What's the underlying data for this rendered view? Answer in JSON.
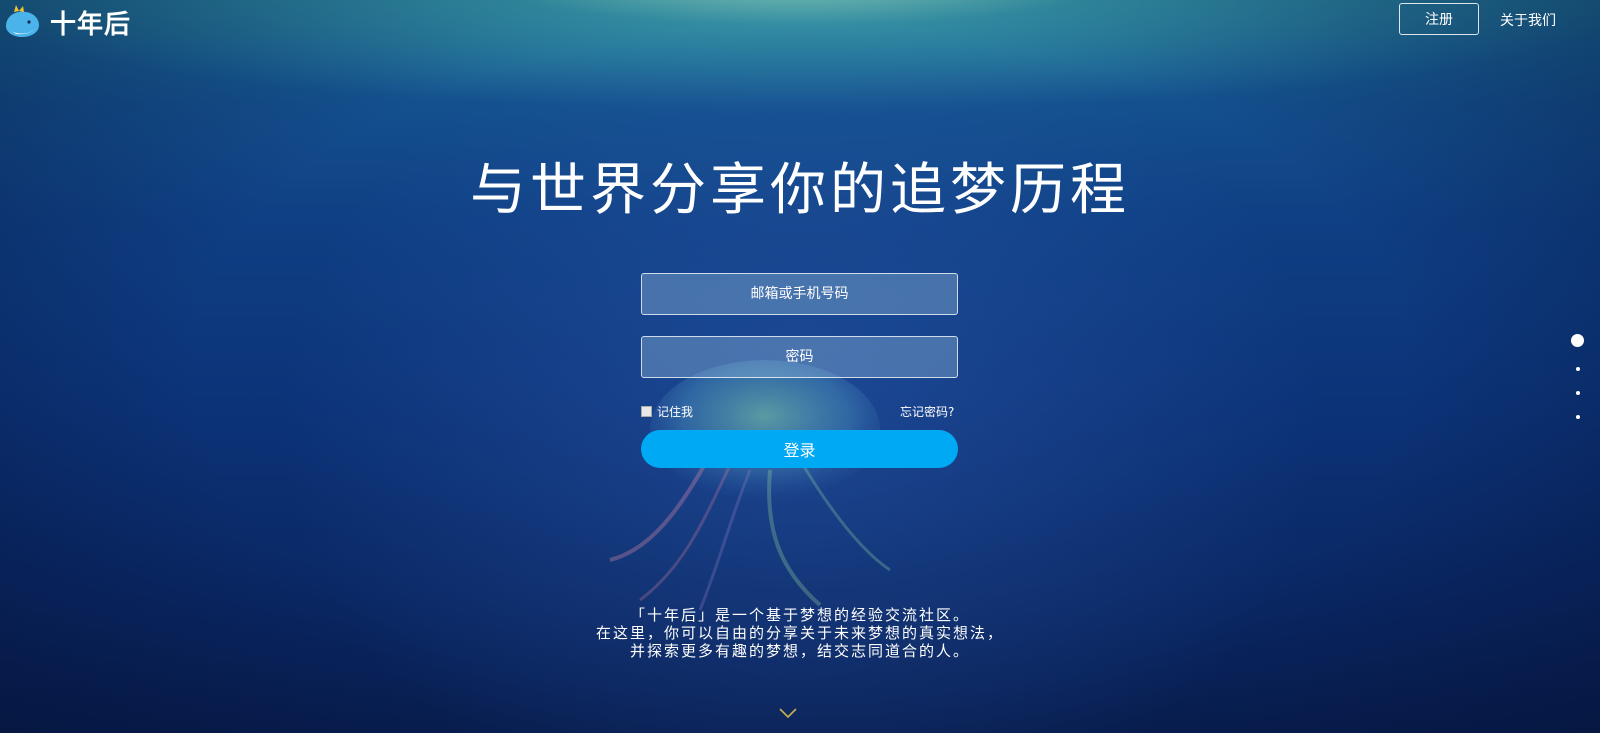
{
  "header": {
    "logo_text": "十年后",
    "register_label": "注册",
    "about_label": "关于我们"
  },
  "headline": "与世界分享你的追梦历程",
  "login": {
    "email_placeholder": "邮箱或手机号码",
    "password_placeholder": "密码",
    "remember_label": "记住我",
    "remember_checked": false,
    "forgot_label": "忘记密码?",
    "submit_label": "登录"
  },
  "page_dots": {
    "count": 4,
    "active_index": 0
  },
  "description": [
    "「十年后」是一个基于梦想的经验交流社区。",
    "在这里，你可以自由的分享关于未来梦想的真实想法，",
    "并探索更多有趣的梦想，结交志同道合的人。"
  ],
  "icons": {
    "logo": "whale-icon",
    "scroll": "chevron-down-icon"
  },
  "colors": {
    "login_button": "#00a9f4",
    "background_top": "#1c6f9c",
    "background_bottom": "#081f52"
  }
}
